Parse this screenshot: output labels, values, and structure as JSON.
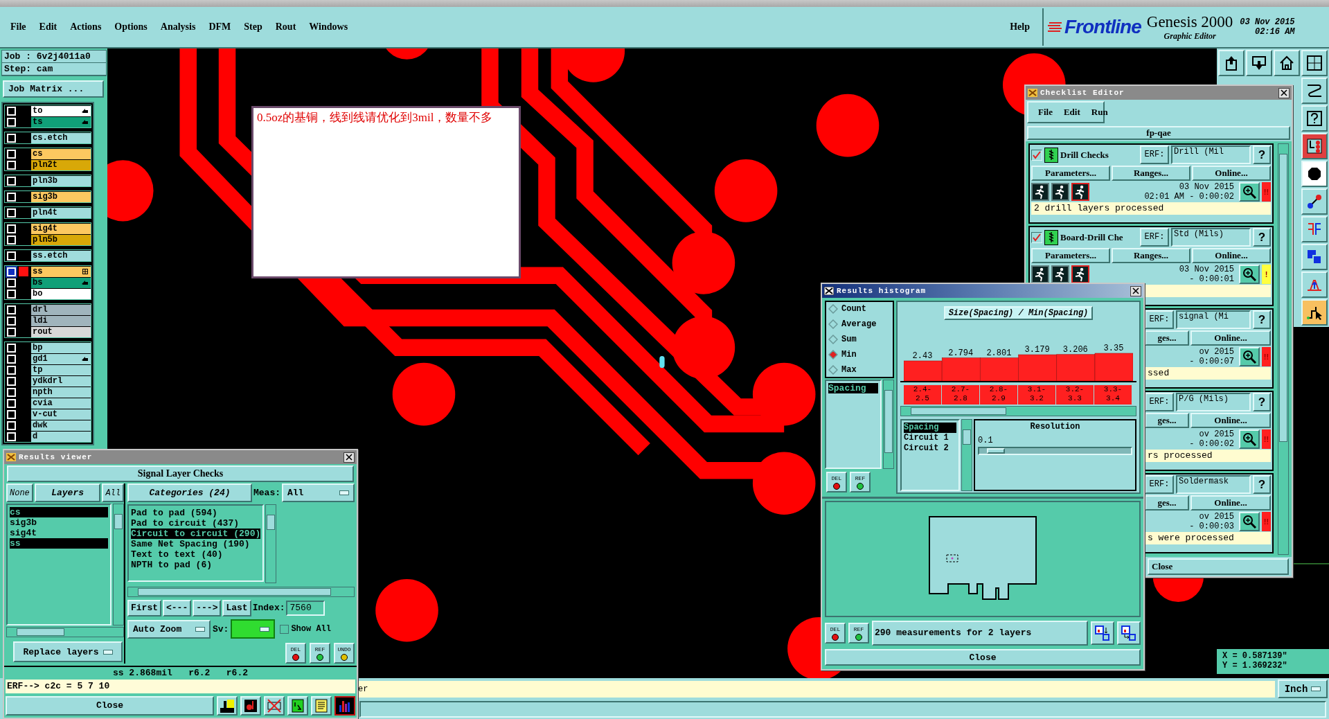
{
  "menu": [
    "File",
    "Edit",
    "Actions",
    "Options",
    "Analysis",
    "DFM",
    "Step",
    "Rout",
    "Windows"
  ],
  "help": "Help",
  "brand": {
    "logo": "Frontline",
    "product": "Genesis 2000",
    "subtitle": "Graphic Editor",
    "date": "03 Nov 2015",
    "time": "02:16 AM"
  },
  "job": {
    "job": "Job : 6v2j4011a0",
    "step": "Step: cam",
    "matrix": "Job Matrix ..."
  },
  "layer_groups": [
    {
      "layers": [
        {
          "name": "to",
          "color": "#ffffff",
          "kind": "arrow",
          "selected": false
        },
        {
          "name": "ts",
          "color": "#10a078",
          "kind": "arrow",
          "selected": false
        }
      ]
    },
    {
      "layers": [
        {
          "name": "cs.etch",
          "color": "#a0dcdc",
          "selected": false
        }
      ]
    },
    {
      "layers": [
        {
          "name": "cs",
          "color": "#fcc860",
          "selected": false
        },
        {
          "name": "pln2t",
          "color": "#d8a808",
          "selected": false
        }
      ]
    },
    {
      "layers": [
        {
          "name": "pln3b",
          "color": "#a0dcdc",
          "selected": false
        }
      ]
    },
    {
      "layers": [
        {
          "name": "sig3b",
          "color": "#fcc860",
          "selected": false
        }
      ]
    },
    {
      "layers": [
        {
          "name": "pln4t",
          "color": "#a0dcdc",
          "selected": false
        }
      ]
    },
    {
      "layers": [
        {
          "name": "sig4t",
          "color": "#fcc860",
          "selected": false
        },
        {
          "name": "pln5b",
          "color": "#d8a808",
          "selected": false
        }
      ]
    },
    {
      "layers": [
        {
          "name": "ss.etch",
          "color": "#a0dcdc",
          "selected": false
        }
      ]
    },
    {
      "layers": [
        {
          "name": "ss",
          "color": "#fcc860",
          "kind": "grid",
          "selected": true
        },
        {
          "name": "bs",
          "color": "#10a078",
          "kind": "arrow",
          "selected": false
        },
        {
          "name": "bo",
          "color": "#ffffff",
          "selected": false
        }
      ]
    },
    {
      "layers": [
        {
          "name": "drl",
          "color": "#a0b4bc",
          "selected": false
        },
        {
          "name": "ldi",
          "color": "#a0b4bc",
          "selected": false
        },
        {
          "name": "rout",
          "color": "#d8d8d8",
          "selected": false
        }
      ]
    },
    {
      "layers": [
        {
          "name": "bp",
          "color": "#a0dcdc",
          "selected": false
        },
        {
          "name": "gd1",
          "color": "#a0dcdc",
          "kind": "arrow",
          "selected": false
        },
        {
          "name": "tp",
          "color": "#a0dcdc",
          "selected": false
        },
        {
          "name": "ydkdrl",
          "color": "#a0dcdc",
          "selected": false
        },
        {
          "name": "npth",
          "color": "#a0dcdc",
          "selected": false
        },
        {
          "name": "cvia",
          "color": "#a0dcdc",
          "selected": false
        },
        {
          "name": "v-cut",
          "color": "#a0dcdc",
          "selected": false
        },
        {
          "name": "dwk",
          "color": "#a0dcdc",
          "selected": false
        },
        {
          "name": "d",
          "color": "#a0dcdc",
          "selected": false
        }
      ]
    }
  ],
  "note": "0.5oz的基铜，线到线请优化到3mil，数量不多",
  "toolbar": [
    {
      "kind": "upload",
      "color": "#9edcdc"
    },
    {
      "kind": "download",
      "color": "#9edcdc"
    },
    {
      "kind": "home",
      "color": "#9edcdc"
    },
    {
      "kind": "grid",
      "color": "#9edcdc"
    },
    {
      "kind": "curve",
      "color": "#9edcdc"
    },
    {
      "kind": "help",
      "color": "#9edcdc"
    },
    {
      "kind": "chip",
      "color": "#e04040"
    },
    {
      "kind": "octagon",
      "color": "#ffffff"
    },
    {
      "kind": "nodes",
      "color": "#9edcdc"
    },
    {
      "kind": "mirror",
      "color": "#9edcdc"
    },
    {
      "kind": "squares",
      "color": "#9edcdc"
    },
    {
      "kind": "triangle",
      "color": "#9edcdc"
    },
    {
      "kind": "pointer",
      "color": "#f8c060"
    }
  ],
  "coords": {
    "x": "X = 0.587139\"",
    "y": "Y = 1.369232\""
  },
  "status": {
    "message": "er",
    "unit": "Inch"
  },
  "results_viewer": {
    "title": "Results viewer",
    "header": "Signal Layer Checks",
    "layer_tabs": [
      "None",
      "Layers",
      "All"
    ],
    "layers": [
      {
        "name": "cs",
        "selected": true
      },
      {
        "name": "sig3b",
        "selected": false
      },
      {
        "name": "sig4t",
        "selected": false
      },
      {
        "name": "ss",
        "selected": true
      }
    ],
    "categories_title": "Categories (24)",
    "meas_label": "Meas:",
    "meas_value": "All",
    "categories": [
      {
        "label": "Pad to pad (594)",
        "selected": false
      },
      {
        "label": "Pad to circuit (437)",
        "selected": false
      },
      {
        "label": "Circuit to circuit (290)",
        "selected": true
      },
      {
        "label": "Same Net Spacing (190)",
        "selected": false
      },
      {
        "label": "Text to text (40)",
        "selected": false
      },
      {
        "label": "NPTH to pad (6)",
        "selected": false
      }
    ],
    "nav": [
      "First",
      "<---",
      "--->",
      "Last"
    ],
    "index_label": "Index:",
    "index_value": "7560",
    "zoom": "Auto Zoom",
    "sv_label": "Sv:",
    "show_all": {
      "label": "Show All",
      "checked": false
    },
    "replace": "Replace layers",
    "actions": [
      {
        "label": "DEL",
        "kind": "del"
      },
      {
        "label": "REF",
        "kind": "ref"
      },
      {
        "label": "UNDO",
        "kind": "undo"
      }
    ],
    "measurement": "ss 2.868mil   r6.2   r6.2",
    "erf": "ERF--> c2c = 5 7 10",
    "close": "Close",
    "tools": [
      {
        "kind": "figure",
        "selected": false
      },
      {
        "kind": "record",
        "selected": false
      },
      {
        "kind": "cross",
        "selected": false
      },
      {
        "kind": "page",
        "selected": false
      },
      {
        "kind": "notes",
        "selected": false
      },
      {
        "kind": "chart",
        "selected": true
      }
    ]
  },
  "checklist": {
    "title": "Checklist Editor",
    "menu": [
      "File",
      "Edit",
      "Run"
    ],
    "name": "fp-qae",
    "checks": [
      {
        "kind": "full",
        "checked": true,
        "name": "Drill Checks",
        "erf_label": "ERF:",
        "erf": "Drill (Mil",
        "help": "?",
        "buttons": [
          "Parameters...",
          "Ranges...",
          "Online..."
        ],
        "date": "03 Nov 2015",
        "time": "02:01 AM - 0:00:02",
        "alert": {
          "text": "!!",
          "kind": "error"
        },
        "status": "2 drill layers processed"
      },
      {
        "kind": "full",
        "checked": true,
        "name": "Board-Drill Che",
        "erf_label": "ERF:",
        "erf": "Std (Mils)",
        "help": "?",
        "buttons": [
          "Parameters...",
          "Ranges...",
          "Online..."
        ],
        "date": "03 Nov 2015",
        "time": "- 0:00:01",
        "alert": {
          "text": "!",
          "kind": "warning"
        }
      },
      {
        "kind": "clipped",
        "erf_label": "ERF:",
        "erf": "signal (Mi",
        "help": "?",
        "buttons": [
          "ges...",
          "Online..."
        ],
        "date": "ov 2015",
        "time": "- 0:00:07",
        "alert": {
          "text": "!!",
          "kind": "error"
        },
        "status": "ssed"
      },
      {
        "kind": "clipped",
        "erf_label": "ERF:",
        "erf": "P/G (Mils)",
        "help": "?",
        "buttons": [
          "ges...",
          "Online..."
        ],
        "date": "ov 2015",
        "time": "- 0:00:02",
        "alert": {
          "text": "!!",
          "kind": "error"
        },
        "status": "rs processed"
      },
      {
        "kind": "clipped",
        "erf_label": "ERF:",
        "erf": "Soldermask",
        "help": "?",
        "buttons": [
          "ges...",
          "Online..."
        ],
        "date": "ov 2015",
        "time": "- 0:00:03",
        "alert": {
          "text": "!!",
          "kind": "error"
        },
        "status": "s were processed"
      }
    ],
    "close": "Close"
  },
  "histogram": {
    "title": "Results histogram",
    "modes": [
      {
        "label": "Count",
        "selected": false
      },
      {
        "label": "Average",
        "selected": false
      },
      {
        "label": "Sum",
        "selected": false
      },
      {
        "label": "Min",
        "selected": true
      },
      {
        "label": "Max",
        "selected": false
      }
    ],
    "measures": [
      {
        "label": "Spacing",
        "selected": true
      }
    ],
    "chart_data": {
      "type": "bar",
      "title": "Size(Spacing) / Min(Spacing)",
      "categories": [
        "2.4-2.5",
        "2.7-2.8",
        "2.8-2.9",
        "3.1-3.2",
        "3.2-3.3",
        "3.3-3.4"
      ],
      "values": [
        2.43,
        2.794,
        2.801,
        3.179,
        3.206,
        3.35
      ],
      "data_labels": true
    },
    "fields": [
      {
        "label": "Spacing",
        "selected": true
      },
      {
        "label": "Circuit 1",
        "selected": false
      },
      {
        "label": "Circuit 2",
        "selected": false
      }
    ],
    "resolution": {
      "label": "Resolution",
      "value": "0.1",
      "level": 0.05
    },
    "list_actions": [
      {
        "label": "DEL",
        "kind": "del"
      },
      {
        "label": "REF",
        "kind": "ref"
      }
    ],
    "footer_actions": [
      {
        "label": "DEL",
        "kind": "del"
      },
      {
        "label": "REF",
        "kind": "ref"
      }
    ],
    "summary": "290 measurements for 2 layers",
    "close": "Close"
  }
}
